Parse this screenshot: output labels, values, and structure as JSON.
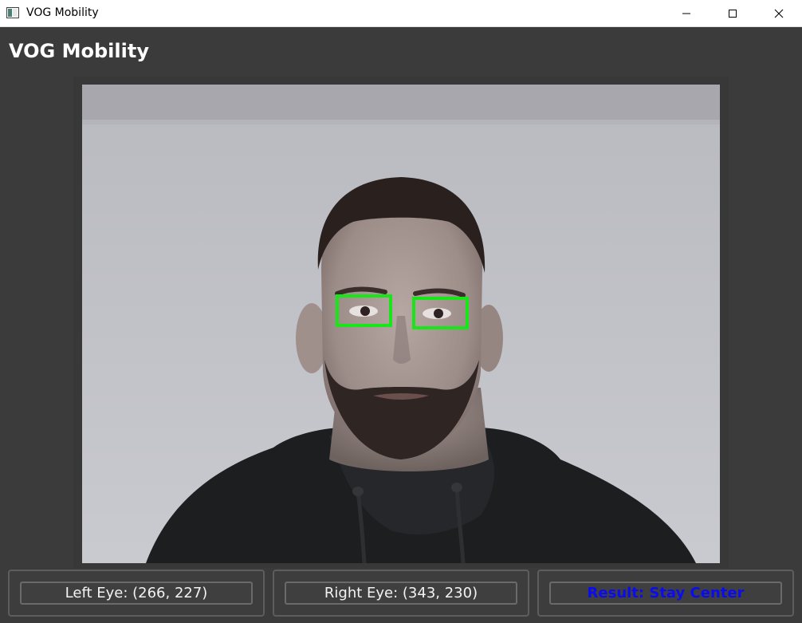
{
  "window": {
    "title": "VOG Mobility",
    "icon": "app-window-icon",
    "controls": [
      "minimize-icon",
      "maximize-icon",
      "close-icon"
    ]
  },
  "header": {
    "title": "VOG Mobility"
  },
  "camera": {
    "overlay_color": "#19e619",
    "detections": [
      "left-eye-box",
      "right-eye-box"
    ]
  },
  "status": {
    "left_eye": "Left Eye: (266, 227)",
    "right_eye": "Right Eye: (343, 230)",
    "result": "Result: Stay Center",
    "result_color": "#0b0bf0"
  }
}
